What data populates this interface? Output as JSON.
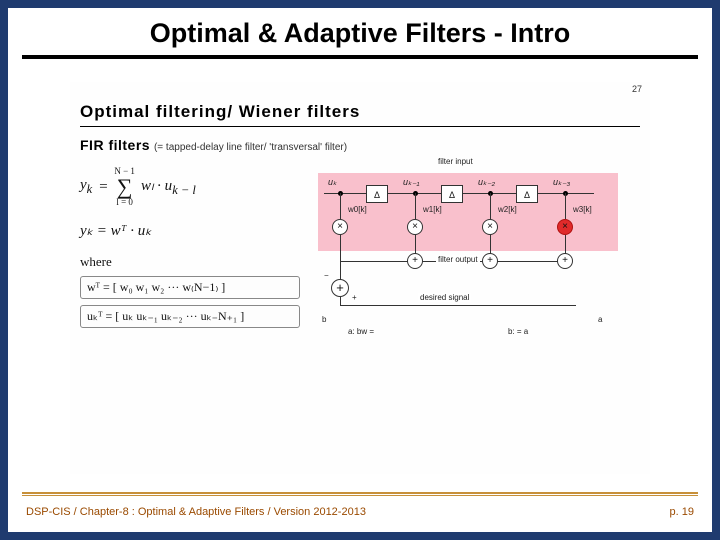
{
  "slide": {
    "title": "Optimal & Adaptive Filters - Intro",
    "inner_page_number": "27",
    "inner_heading": "Optimal filtering/ Wiener filters",
    "subheading_strong": "FIR filters",
    "subheading_paren": "(= tapped-delay line filter/ 'transversal' filter)",
    "eq_sum_lhs": "y",
    "eq_sum_sub": "k",
    "eq_sum_eq": "=",
    "eq_sum_top": "N − 1",
    "eq_sum_bot": "l = 0",
    "eq_sum_term": "wₗ · u",
    "eq_sum_term_sub": "k − l",
    "eq_vec": "yₖ = wᵀ · uₖ",
    "where_label": "where",
    "w_vec": "wᵀ = [ w₀ w₁ w₂ ··· w₍N−1₎ ]",
    "u_vec": "uₖᵀ = [ uₖ uₖ₋₁ uₖ₋₂ ··· uₖ₋N₊₁ ]"
  },
  "diagram": {
    "filter_input_label": "filter input",
    "filter_output_label": "filter output",
    "desired_label": "desired signal",
    "delay_label": "Δ",
    "u0": "uₖ",
    "u1": "uₖ₋₁",
    "u2": "uₖ₋₂",
    "u3": "uₖ₋₃",
    "w0": "w0[k]",
    "w1": "w1[k]",
    "w2": "w2[k]",
    "w3": "w3[k]",
    "plus": "+",
    "minus": "−",
    "corner_a": "a",
    "corner_b": "b",
    "rel_a": "a: bw =",
    "rel_b": "b: =  a"
  },
  "footer": {
    "left": "DSP-CIS / Chapter-8 : Optimal & Adaptive Filters / Version 2012-2013",
    "right": "p. 19"
  }
}
